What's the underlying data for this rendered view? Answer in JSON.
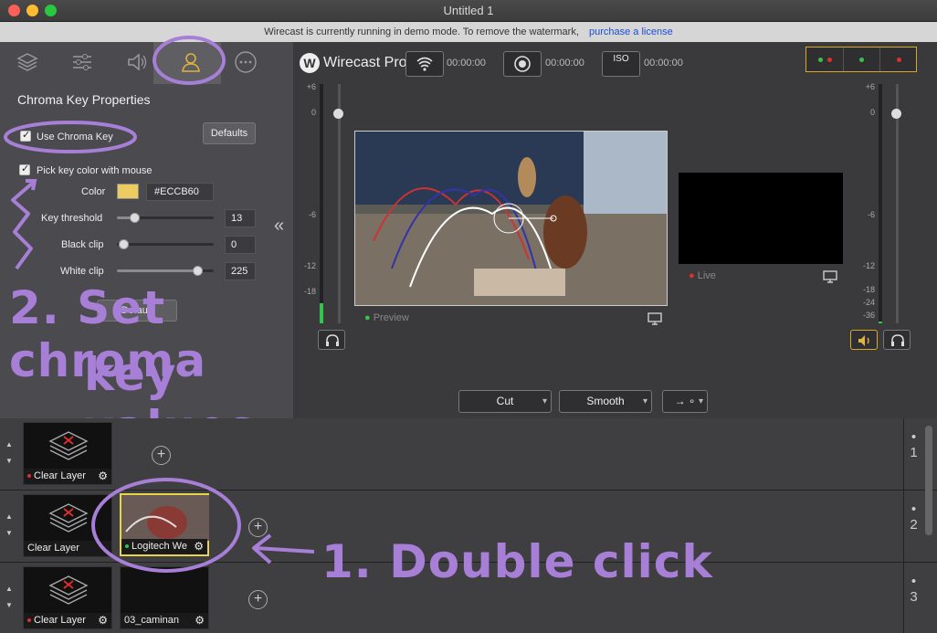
{
  "window": {
    "title": "Untitled 1"
  },
  "banner": {
    "text": "Wirecast is currently running in demo mode. To remove the watermark,",
    "link": "purchase a license"
  },
  "tabs": [
    {
      "icon": "layers-icon"
    },
    {
      "icon": "sliders-icon"
    },
    {
      "icon": "speaker-icon"
    },
    {
      "icon": "user-icon",
      "active": true
    },
    {
      "icon": "more-icon"
    }
  ],
  "chroma": {
    "title": "Chroma Key Properties",
    "use_label": "Use Chroma Key",
    "defaults_label": "Defaults",
    "pick_label": "Pick key color with mouse",
    "color_label": "Color",
    "color_hex": "#ECCB60",
    "threshold_label": "Key threshold",
    "threshold_value": "13",
    "black_label": "Black clip",
    "black_value": "0",
    "white_label": "White clip",
    "white_value": "225",
    "default_btn": "Default",
    "collapse": "«"
  },
  "annotations": {
    "step2_line1": "2. Set chroma",
    "step2_line2": "key values",
    "step1": "1. Double click"
  },
  "toolbar": {
    "logo_text": "Wirecast Pro",
    "stream_time": "00:00:00",
    "record_time": "00:00:00",
    "iso_time": "00:00:00",
    "iso_label": "ISO"
  },
  "preview": {
    "label": "Preview"
  },
  "live": {
    "label": "Live"
  },
  "left_scale": [
    "+6",
    "0",
    "-6",
    "-12",
    "-18"
  ],
  "right_scale": [
    "+6",
    "0",
    "-6",
    "-12",
    "-18",
    "-24",
    "-36"
  ],
  "transitions": {
    "cut": "Cut",
    "smooth": "Smooth",
    "go": "→ ∘"
  },
  "layers": [
    {
      "number": "1",
      "shots": [
        {
          "label": "Clear Layer",
          "dot": "#e0302b"
        }
      ]
    },
    {
      "number": "2",
      "shots": [
        {
          "label": "Clear Layer",
          "dot": ""
        },
        {
          "label": "Logitech We",
          "dot": "#37c24d"
        }
      ]
    },
    {
      "number": "3",
      "shots": [
        {
          "label": "Clear Layer",
          "dot": "#e0302b"
        },
        {
          "label": "03_caminan",
          "dot": ""
        }
      ]
    }
  ]
}
